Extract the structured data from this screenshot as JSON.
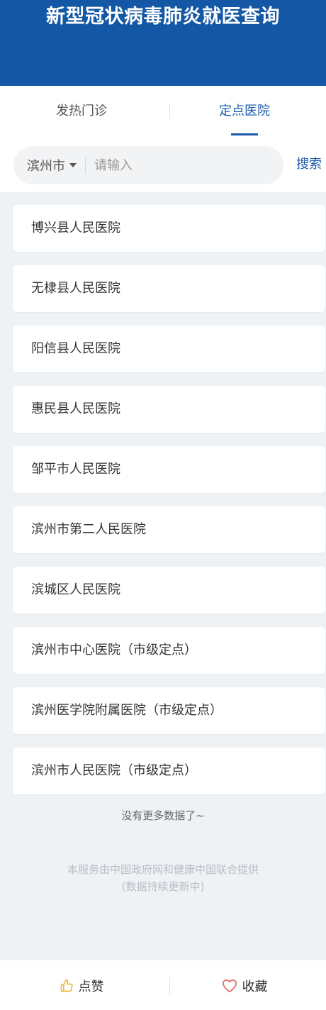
{
  "header": {
    "title": "新型冠状病毒肺炎就医查询"
  },
  "tabs": [
    {
      "label": "发热门诊",
      "active": false
    },
    {
      "label": "定点医院",
      "active": true
    }
  ],
  "search": {
    "city": "滨州市",
    "placeholder": "请输入",
    "button_label": "搜索"
  },
  "hospitals": [
    "博兴县人民医院",
    "无棣县人民医院",
    "阳信县人民医院",
    "惠民县人民医院",
    "邹平市人民医院",
    "滨州市第二人民医院",
    "滨城区人民医院",
    "滨州市中心医院（市级定点）",
    "滨州医学院附属医院（市级定点）",
    "滨州市人民医院（市级定点）"
  ],
  "list_end_text": "没有更多数据了~",
  "footer_note": {
    "line1": "本服务由中国政府网和健康中国联合提供",
    "line2": "(数据持续更新中)"
  },
  "bottom_bar": {
    "like_label": "点赞",
    "favorite_label": "收藏"
  },
  "colors": {
    "header_bg": "#1357a5",
    "accent": "#1a5cab",
    "like_icon": "#f0b73a",
    "favorite_icon": "#e07070"
  }
}
